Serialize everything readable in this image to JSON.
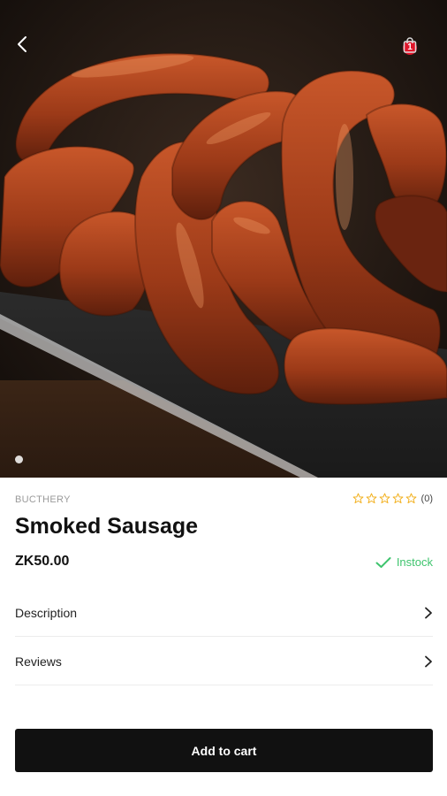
{
  "product": {
    "category": "BUCTHERY",
    "title": "Smoked Sausage",
    "price": "ZK50.00",
    "stock_status": "Instock",
    "rating_value": 0,
    "rating_max": 5,
    "review_count": "(0)"
  },
  "header": {
    "cart_badge": "1",
    "back_icon": "chevron-left-icon",
    "cart_icon": "shopping-bag-icon"
  },
  "gallery": {
    "image_subject": "sausage-photo",
    "active_index": 0,
    "total": 1
  },
  "sections": {
    "description_label": "Description",
    "reviews_label": "Reviews"
  },
  "actions": {
    "add_to_cart_label": "Add to cart"
  },
  "colors": {
    "badge": "#e0152a",
    "instock": "#3ec46d",
    "star": "#f2b01e",
    "button_bg": "#111111"
  }
}
